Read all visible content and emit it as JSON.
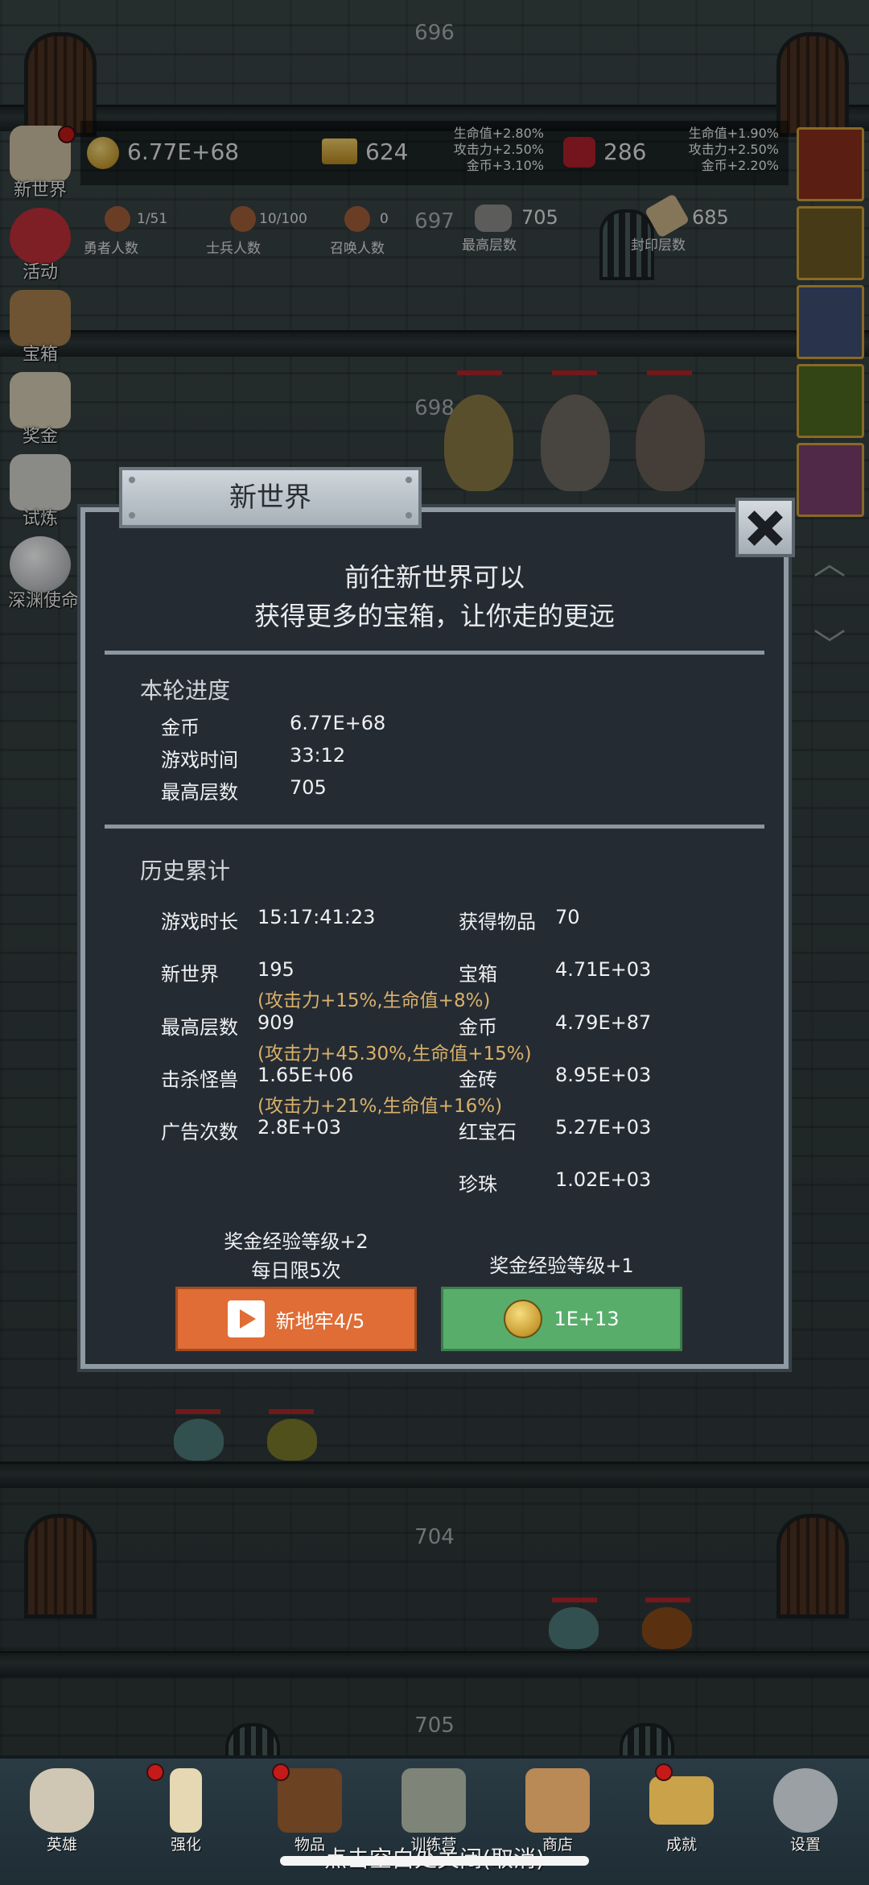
{
  "floors": [
    "696",
    "697",
    "698",
    "704",
    "705"
  ],
  "top_stats": {
    "gold": "6.77E+68",
    "gold_bar": "624",
    "ruby": "286",
    "bonus_left": [
      "生命值+2.80%",
      "攻击力+2.50%",
      "金币+3.10%"
    ],
    "bonus_right": [
      "生命值+1.90%",
      "攻击力+2.50%",
      "金币+2.20%"
    ],
    "hero_count": "1/51",
    "hero_label": "勇者人数",
    "soldier_count": "10/100",
    "soldier_label": "士兵人数",
    "summon_count": "0",
    "summon_label": "召唤人数",
    "max_floor": "705",
    "max_floor_label": "最高层数",
    "sealed_floor": "685",
    "sealed_floor_label": "封印层数"
  },
  "side_menu": [
    "新世界",
    "活动",
    "宝箱",
    "奖金",
    "试炼",
    "深渊使命"
  ],
  "modal": {
    "tab_title": "新世界",
    "intro_line1": "前往新世界可以",
    "intro_line2": "获得更多的宝箱，让你走的更远",
    "round_title": "本轮进度",
    "round_rows": [
      {
        "label": "金币",
        "value": "6.77E+68"
      },
      {
        "label": "游戏时间",
        "value": "33:12"
      },
      {
        "label": "最高层数",
        "value": "705"
      }
    ],
    "history_title": "历史累计",
    "history_left": [
      {
        "label": "游戏时长",
        "value": "15:17:41:23",
        "bonus": ""
      },
      {
        "label": "新世界",
        "value": "195",
        "bonus": "(攻击力+15%,生命值+8%)"
      },
      {
        "label": "最高层数",
        "value": "909",
        "bonus": "(攻击力+45.30%,生命值+15%)"
      },
      {
        "label": "击杀怪兽",
        "value": "1.65E+06",
        "bonus": "(攻击力+21%,生命值+16%)"
      },
      {
        "label": "广告次数",
        "value": "2.8E+03",
        "bonus": ""
      }
    ],
    "history_right": [
      {
        "label": "获得物品",
        "value": "70"
      },
      {
        "label": "宝箱",
        "value": "4.71E+03"
      },
      {
        "label": "金币",
        "value": "4.79E+87"
      },
      {
        "label": "金砖",
        "value": "8.95E+03"
      },
      {
        "label": "红宝石",
        "value": "5.27E+03"
      },
      {
        "label": "珍珠",
        "value": "1.02E+03"
      }
    ],
    "left_note_line1": "奖金经验等级+2",
    "left_note_line2": "每日限5次",
    "right_note": "奖金经验等级+1",
    "btn_ad_label": "新地牢4/5",
    "btn_coin_label": "1E+13"
  },
  "bottom_nav": [
    "英雄",
    "强化",
    "物品",
    "训练营",
    "商店",
    "成就",
    "设置"
  ],
  "hint": "点击空白处关闭(取消)",
  "colors": {
    "orange_button": "#df6d35",
    "green_button": "#58ad6b",
    "gold_text": "#d8b16a",
    "modal_bg": "#252b33"
  }
}
